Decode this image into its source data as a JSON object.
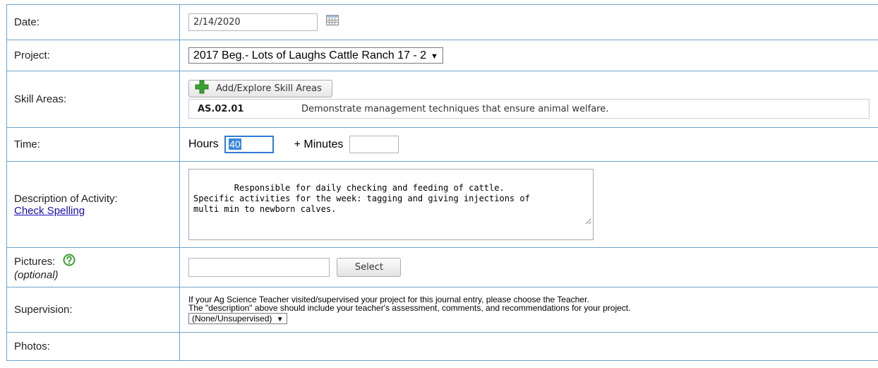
{
  "rows": {
    "date": {
      "label": "Date:",
      "value": "2/14/2020",
      "icon": "calendar-icon"
    },
    "project": {
      "label": "Project:",
      "selected": "2017 Beg.- Lots of Laughs Cattle Ranch 17 - 2",
      "caret": "▼"
    },
    "skill_areas": {
      "label": "Skill Areas:",
      "button_label": "Add/Explore Skill Areas",
      "button_icon": "plus-icon",
      "items": [
        {
          "code": "AS.02.01",
          "description": "Demonstrate management techniques that ensure animal welfare."
        }
      ]
    },
    "time": {
      "label": "Time:",
      "hours_label": "Hours",
      "hours_value": "40",
      "minutes_label": "+ Minutes",
      "minutes_value": ""
    },
    "description": {
      "label": "Description of Activity:",
      "spell_link": "Check Spelling",
      "text": "Responsible for daily checking and feeding of cattle.\nSpecific activities for the week: tagging and giving injections of\nmulti min to newborn calves."
    },
    "pictures": {
      "label": "Pictures:",
      "optional": "(optional)",
      "select_label": "Select",
      "help_icon": "help-question-icon"
    },
    "supervision": {
      "label": "Supervision:",
      "line1": "If your Ag Science Teacher visited/supervised your project for this journal entry, please choose the Teacher.",
      "line2": "The \"description\" above should include your teacher's assessment, comments, and recommendations for your project.",
      "selected": "(None/Unsupervised)",
      "caret": "▼"
    },
    "photos": {
      "label": "Photos:"
    }
  },
  "colors": {
    "border": "#6fa3cc",
    "accent_green": "#3aa12e",
    "focus_blue": "#2f7bd6",
    "link": "#1a0dab"
  }
}
